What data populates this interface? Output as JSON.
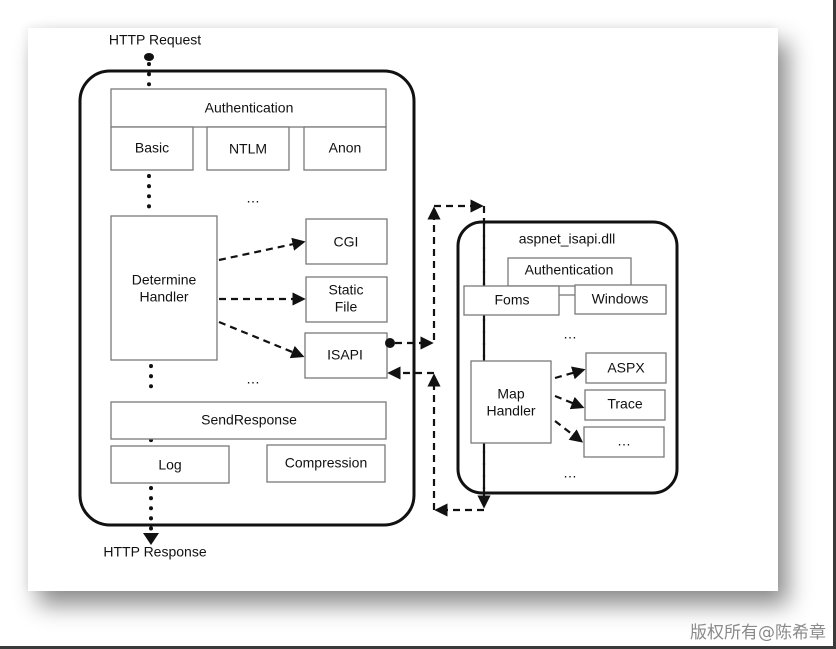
{
  "diagram": {
    "http_request": "HTTP Request",
    "http_response": "HTTP Response",
    "iis": {
      "authentication": "Authentication",
      "auth_methods": [
        "Basic",
        "NTLM",
        "Anon"
      ],
      "ellipsis": "…",
      "determine_handler": [
        "Determine",
        "Handler"
      ],
      "handlers": {
        "cgi": "CGI",
        "static_file": [
          "Static",
          "File"
        ],
        "isapi": "ISAPI"
      },
      "send_response": "SendResponse",
      "log": "Log",
      "compression": "Compression"
    },
    "aspnet": {
      "title": "aspnet_isapi.dll",
      "authentication": "Authentication",
      "auth_methods": [
        "Foms",
        "Windows"
      ],
      "ellipsis": "…",
      "map_handler": [
        "Map",
        "Handler"
      ],
      "handlers": [
        "ASPX",
        "Trace",
        "…"
      ]
    }
  },
  "watermark": "版权所有@陈希章"
}
